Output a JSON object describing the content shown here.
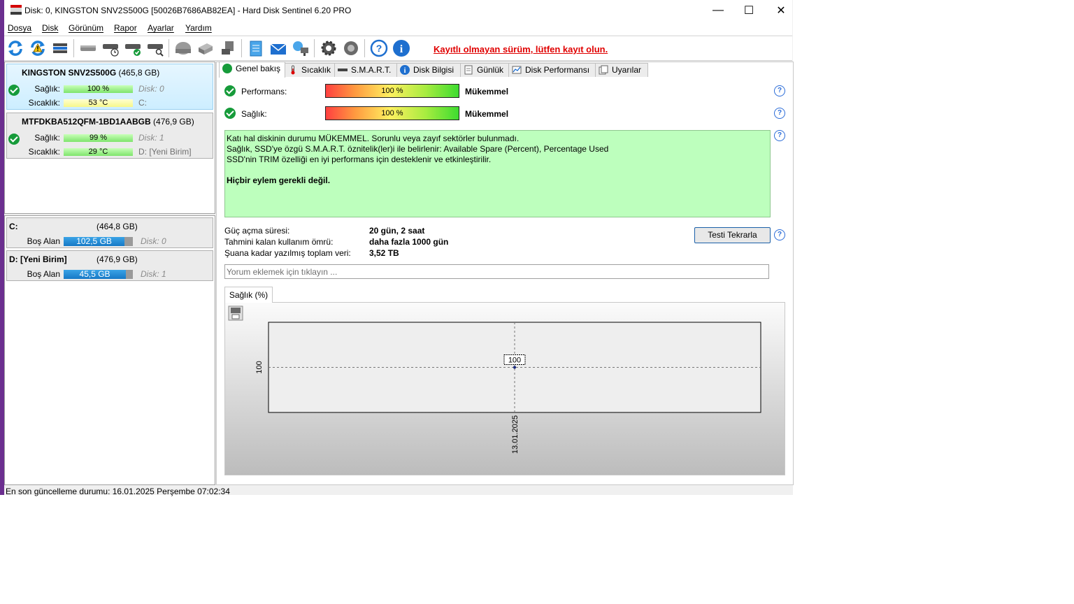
{
  "window": {
    "title": "Disk: 0, KINGSTON SNV2S500G [50026B7686AB82EA]  -  Hard Disk Sentinel 6.20 PRO",
    "controls": {
      "minimize": "—",
      "maximize": "☐",
      "close": "✕"
    }
  },
  "menu": [
    "Dosya",
    "Disk",
    "Görünüm",
    "Rapor",
    "Ayarlar",
    "Yardım"
  ],
  "toolbar": {
    "icons": [
      "refresh-icon",
      "refresh-warning-icon",
      "disk-list-icon",
      "disk-gray-icon",
      "disk-clock-icon",
      "disk-check-icon",
      "disk-search-icon",
      "drive-gray-icon",
      "drive-transfer-icon",
      "drive-usb-icon",
      "notepad-icon",
      "mail-icon",
      "network-icon",
      "settings-icon",
      "sound-icon",
      "help-icon",
      "info-icon"
    ],
    "registration_notice": "Kayıtlı olmayan sürüm, lütfen kayıt olun.",
    "notice_color": "#e00000"
  },
  "disks": [
    {
      "name": "KINGSTON SNV2S500G",
      "size": "(465,8 GB)",
      "health_label": "Sağlık:",
      "health": "100 %",
      "health_fraction": 1.0,
      "disk_no": "Disk: 0",
      "temp_label": "Sıcaklık:",
      "temp": "53 °C",
      "volume": "C:"
    },
    {
      "name": "MTFDKBA512QFM-1BD1AABGB",
      "size": "(476,9 GB)",
      "health_label": "Sağlık:",
      "health": "99 %",
      "health_fraction": 0.99,
      "disk_no": "Disk: 1",
      "temp_label": "Sıcaklık:",
      "temp": "29 °C",
      "volume": "D: [Yeni Birim]"
    }
  ],
  "volumes": [
    {
      "name": "C:",
      "size": "(464,8 GB)",
      "free_label": "Boş Alan",
      "free": "102,5 GB",
      "free_fraction": 0.88,
      "disk_no": "Disk: 0"
    },
    {
      "name": "D: [Yeni Birim]",
      "size": "(476,9 GB)",
      "free_label": "Boş Alan",
      "free": "45,5 GB",
      "free_fraction": 0.9,
      "disk_no": "Disk: 1"
    }
  ],
  "tabs": [
    "Genel bakış",
    "Sıcaklık",
    "S.M.A.R.T.",
    "Disk Bilgisi",
    "Günlük",
    "Disk Performansı",
    "Uyarılar"
  ],
  "overview": {
    "performance_label": "Performans:",
    "performance_value": "100 %",
    "performance_rating": "Mükemmel",
    "health_label": "Sağlık:",
    "health_value": "100 %",
    "health_rating": "Mükemmel",
    "message_lines": [
      "Katı hal diskinin durumu MÜKEMMEL. Sorunlu veya zayıf sektörler bulunmadı.",
      "Sağlık, SSD'ye özgü S.M.A.R.T. öznitelik(ler)i ile belirlenir:  Available Spare (Percent), Percentage Used",
      "SSD'nin TRIM özelliği en iyi performans için desteklenir ve etkinleştirilir."
    ],
    "message_action": "Hiçbir eylem gerekli değil.",
    "power_on_label": "Güç açma süresi:",
    "power_on_value": "20 gün, 2 saat",
    "remaining_label": "Tahmini kalan kullanım ömrü:",
    "remaining_value": "daha fazla 1000 gün",
    "written_label": "Şuana kadar yazılmış toplam veri:",
    "written_value": "3,52 TB",
    "retest_button": "Testi Tekrarla",
    "comment_placeholder": "Yorum eklemek için tıklayın ..."
  },
  "chart_tab": "Sağlık (%)",
  "chart_data": {
    "type": "line",
    "x": [
      "13.01.2025"
    ],
    "series": [
      {
        "values": [
          100
        ]
      }
    ],
    "data_labels": [
      "100"
    ],
    "ytick": "100",
    "xtick": "13.01.2025"
  },
  "status": "En son güncelleme durumu: 16.01.2025 Perşembe 07:02:34"
}
